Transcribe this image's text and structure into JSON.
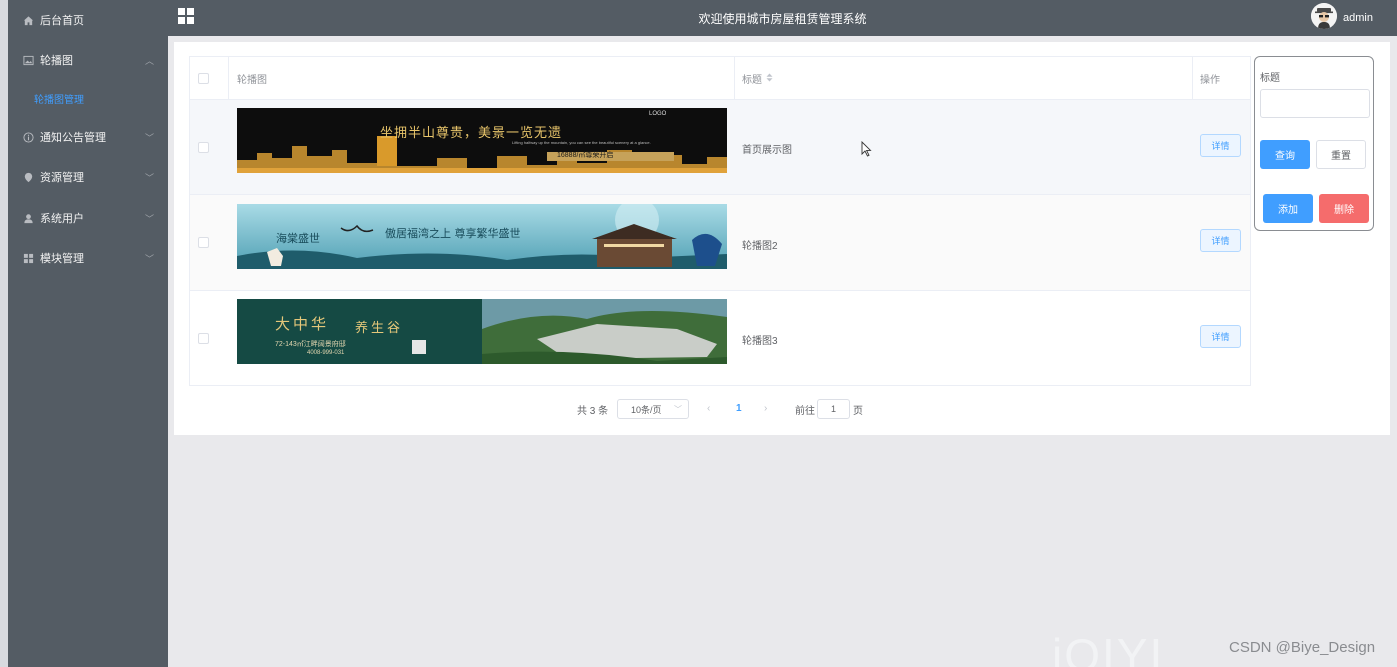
{
  "header": {
    "title": "欢迎使用城市房屋租赁管理系统",
    "username": "admin"
  },
  "sidebar": {
    "items": [
      {
        "label": "后台首页",
        "icon": "home-icon"
      },
      {
        "label": "轮播图",
        "icon": "picture-icon",
        "expanded": true
      },
      {
        "label": "通知公告管理",
        "icon": "info-icon"
      },
      {
        "label": "资源管理",
        "icon": "location-icon"
      },
      {
        "label": "系统用户",
        "icon": "user-icon"
      },
      {
        "label": "模块管理",
        "icon": "grid-icon"
      }
    ],
    "submenu": {
      "label": "轮播图管理"
    }
  },
  "table": {
    "headers": {
      "image": "轮播图",
      "title": "标题",
      "action": "操作"
    },
    "rows": [
      {
        "title": "首页展示图",
        "banner": {
          "line1": "坐拥半山尊贵，美景一览无遗",
          "logo": "LOGO",
          "sub": "Lifting halfway up the mountain, you can see the beautiful scenery at a glance.",
          "price": "16888/㎡尊荣开启"
        }
      },
      {
        "title": "轮播图2",
        "banner": {
          "line1": "海棠盛世",
          "line2": "傲居福湾之上 尊享繁华盛世"
        }
      },
      {
        "title": "轮播图3",
        "banner": {
          "line1": "大中华",
          "line2": "养生谷",
          "area": "72-143㎡江畔阔景府邸",
          "phone": "4008-999-031"
        }
      }
    ],
    "detail_label": "详情"
  },
  "search": {
    "label": "标题",
    "value": "",
    "query_label": "查询",
    "reset_label": "重置",
    "add_label": "添加",
    "delete_label": "删除"
  },
  "pagination": {
    "total": "共 3 条",
    "page_size": "10条/页",
    "current_page": "1",
    "goto_prefix": "前往",
    "goto_value": "1",
    "goto_suffix": "页"
  },
  "watermark": {
    "text": "CSDN @Biye_Design",
    "logo": "iQIYI"
  },
  "colors": {
    "sidebar": "#545c64",
    "accent": "#409eff",
    "danger": "#f56c6c"
  }
}
